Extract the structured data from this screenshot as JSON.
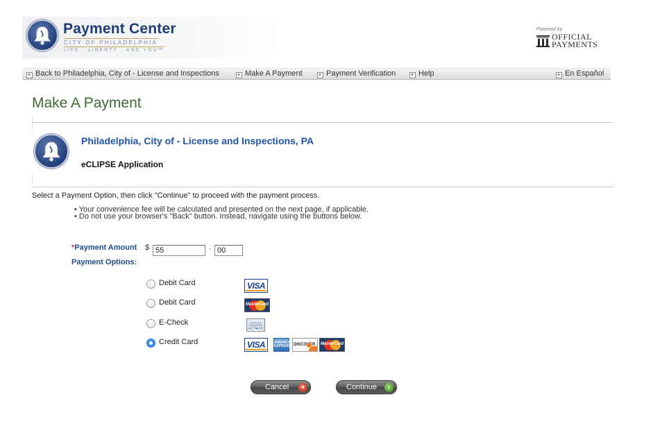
{
  "header": {
    "brand_title": "Payment Center",
    "brand_city": "CITY OF PHILADELPHIA",
    "brand_tagline": "LIFE · LIBERTY · AND YOU™",
    "powered_by": "Powered by",
    "official_line1": "OFFICIAL",
    "official_line2": "PAYMENTS"
  },
  "nav": {
    "items": [
      {
        "label": "Back to Philadelphia, City of - License and Inspections"
      },
      {
        "label": "Make A Payment"
      },
      {
        "label": "Payment Verification"
      },
      {
        "label": "Help"
      }
    ],
    "language_link": "En Español",
    "box_glyph": "▸"
  },
  "page": {
    "title": "Make A Payment",
    "merchant_name": "Philadelphia, City of - License and Inspections, PA",
    "application_name": "eCLIPSE Application",
    "instructions": "Select a Payment Option, then click \"Continue\" to proceed with the payment process.",
    "notes": [
      "• Your convenience fee will be calculated and presented on the next page, if applicable.",
      "• Do not use your browser's \"Back\" button. Instead, navigate using the buttons below."
    ]
  },
  "form": {
    "amount_required_marker": "*",
    "amount_label": "Payment Amount",
    "currency_symbol": "$",
    "amount_dollars": "55",
    "decimal_separator": "·",
    "amount_cents": "00",
    "options_label": "Payment Options:",
    "options": [
      {
        "label": "Debit Card",
        "selected": false,
        "logos": [
          "visa"
        ]
      },
      {
        "label": "Debit Card",
        "selected": false,
        "logos": [
          "mastercard"
        ]
      },
      {
        "label": "E-Check",
        "selected": false,
        "logos": [
          "echeck"
        ]
      },
      {
        "label": "Credit Card",
        "selected": true,
        "logos": [
          "visa",
          "amex",
          "discover",
          "mastercard"
        ]
      }
    ],
    "logo_text": {
      "visa": "VISA",
      "mastercard": "MasterCard",
      "amex": "AMERICAN EXPRESS",
      "discover": "DISCOVER",
      "echeck": "eCheck"
    }
  },
  "buttons": {
    "cancel": "Cancel",
    "cancel_icon": "×",
    "continue": "Continue",
    "continue_icon": "›"
  },
  "colors": {
    "title_green": "#3e6b34",
    "link_blue": "#1f55a6",
    "label_blue": "#1d4c8e",
    "brand_navy": "#1e3c78"
  }
}
